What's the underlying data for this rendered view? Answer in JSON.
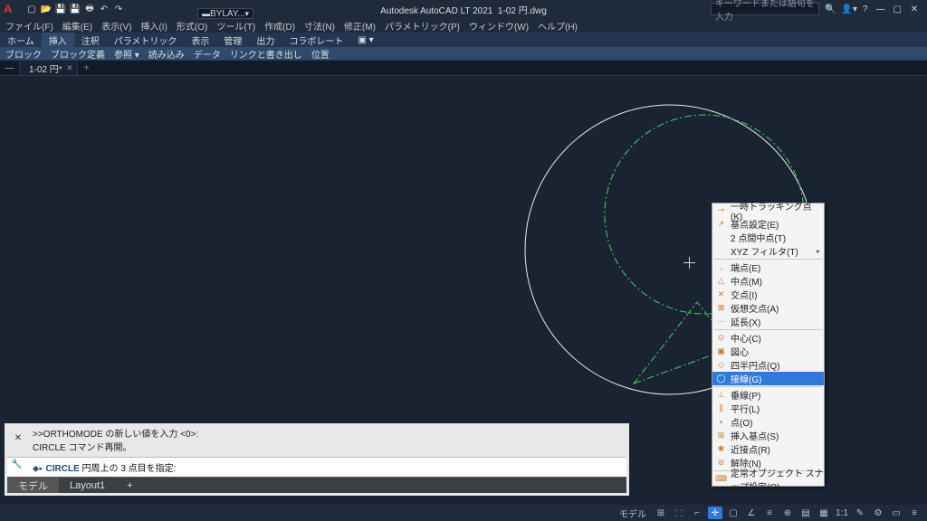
{
  "title_app": "Autodesk AutoCAD LT 2021",
  "title_file": "1-02 円.dwg",
  "search_placeholder": "キーワードまたは語句を入力",
  "layer_dd": "BYLAY...",
  "menus": [
    "ファイル(F)",
    "編集(E)",
    "表示(V)",
    "挿入(I)",
    "形式(O)",
    "ツール(T)",
    "作成(D)",
    "寸法(N)",
    "修正(M)",
    "パラメトリック(P)",
    "ウィンドウ(W)",
    "ヘルプ(H)"
  ],
  "ribbon_tabs": [
    "ホーム",
    "挿入",
    "注釈",
    "パラメトリック",
    "表示",
    "管理",
    "出力",
    "コラボレート"
  ],
  "ribbon_panels": [
    "ブロック",
    "ブロック定義",
    "参照 ▾",
    "読み込み",
    "データ",
    "リンクと書き出し",
    "位置"
  ],
  "doc_tab": "1-02 円*",
  "ctx": {
    "g1": [
      "一時トラッキング点(K)",
      "基点設定(E)",
      "2 点間中点(T)",
      "XYZ フィルタ(T)"
    ],
    "g2": [
      "端点(E)",
      "中点(M)",
      "交点(I)",
      "仮想交点(A)",
      "延長(X)"
    ],
    "g3": [
      "中心(C)",
      "図心",
      "四半円点(Q)",
      "接線(G)"
    ],
    "g4": [
      "垂線(P)",
      "平行(L)",
      "点(O)",
      "挿入基点(S)",
      "近接点(R)",
      "解除(N)"
    ],
    "g5": [
      "定常オブジェクト スナップ設定(Q)..."
    ]
  },
  "cmd_hist1": ">>ORTHOMODE の新しい値を入力 <0>:",
  "cmd_hist2": "CIRCLE コマンド再開。",
  "cmd_kw": "CIRCLE",
  "cmd_rest": " 円周上の 3 点目を指定:",
  "layout_tabs": [
    "モデル",
    "Layout1"
  ],
  "status_label": "モデル"
}
